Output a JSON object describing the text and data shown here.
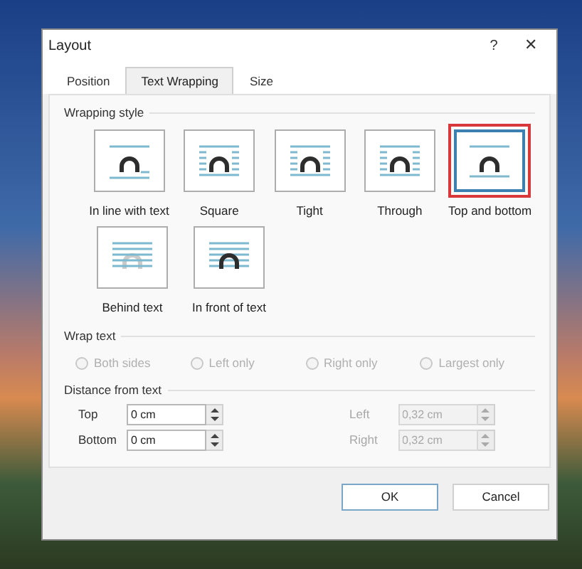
{
  "window": {
    "title": "Layout",
    "help": "?",
    "close": "✕"
  },
  "tabs": [
    {
      "label": "Position",
      "selected": false
    },
    {
      "label": "Text Wrapping",
      "selected": true
    },
    {
      "label": "Size",
      "selected": false
    }
  ],
  "wrapping_style": {
    "heading": "Wrapping style",
    "options": [
      {
        "kind": "inline",
        "label": "In line with text",
        "selected": false
      },
      {
        "kind": "square",
        "label": "Square",
        "selected": false
      },
      {
        "kind": "tight",
        "label": "Tight",
        "selected": false
      },
      {
        "kind": "through",
        "label": "Through",
        "selected": false
      },
      {
        "kind": "top_bottom",
        "label": "Top and bottom",
        "selected": true
      },
      {
        "kind": "behind",
        "label": "Behind text",
        "selected": false
      },
      {
        "kind": "in_front",
        "label": "In front of text",
        "selected": false
      }
    ]
  },
  "wrap_text": {
    "heading": "Wrap text",
    "options": [
      {
        "label": "Both sides",
        "checked": false,
        "disabled": true
      },
      {
        "label": "Left only",
        "checked": false,
        "disabled": true
      },
      {
        "label": "Right only",
        "checked": false,
        "disabled": true
      },
      {
        "label": "Largest only",
        "checked": false,
        "disabled": true
      }
    ]
  },
  "distance": {
    "heading": "Distance from text",
    "fields": [
      {
        "label": "Top",
        "value": "0 cm",
        "disabled": false
      },
      {
        "label": "Left",
        "value": "0,32 cm",
        "disabled": true
      },
      {
        "label": "Bottom",
        "value": "0 cm",
        "disabled": false
      },
      {
        "label": "Right",
        "value": "0,32 cm",
        "disabled": true
      }
    ]
  },
  "buttons": [
    {
      "label": "OK",
      "default": true
    },
    {
      "label": "Cancel",
      "default": false
    }
  ]
}
